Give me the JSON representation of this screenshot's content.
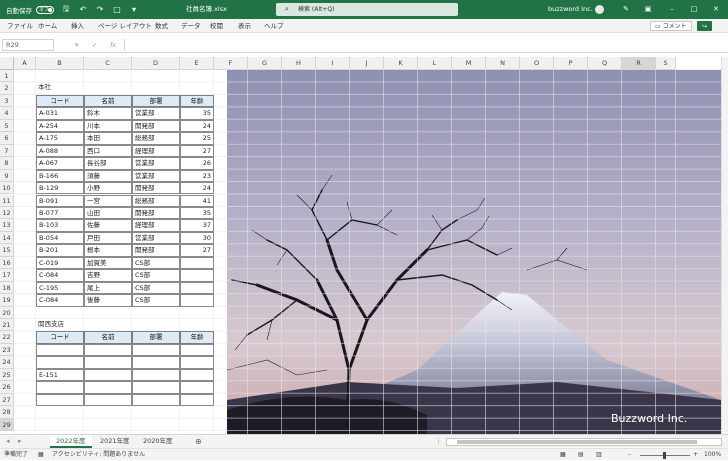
{
  "titlebar": {
    "autosave_label": "自動保存",
    "autosave_state": "オフ",
    "doc_title": "社員名簿.xlsx",
    "search_placeholder": "検索 (Alt+Q)",
    "user_name": "buzzword Inc.",
    "bg_color": "#217346"
  },
  "menu": {
    "items": [
      "ファイル",
      "ホーム",
      "挿入",
      "ページ レイアウト",
      "数式",
      "データ",
      "校閲",
      "表示",
      "ヘルプ"
    ],
    "comment_label": "コメント",
    "share_label": "共有"
  },
  "formula": {
    "cell_ref": "R29",
    "fx": "fx"
  },
  "columns": [
    "A",
    "B",
    "C",
    "D",
    "E",
    "F",
    "G",
    "H",
    "I",
    "J",
    "K",
    "L",
    "M",
    "N",
    "O",
    "P",
    "Q",
    "R",
    "S"
  ],
  "rows": [
    "1",
    "2",
    "3",
    "4",
    "5",
    "6",
    "7",
    "8",
    "9",
    "10",
    "11",
    "12",
    "13",
    "14",
    "15",
    "16",
    "17",
    "18",
    "19",
    "20",
    "21",
    "22",
    "23",
    "24",
    "25",
    "26",
    "27",
    "28",
    "29"
  ],
  "table1": {
    "title": "本社",
    "headers": [
      "コード",
      "名前",
      "部署",
      "年齢"
    ],
    "rows": [
      [
        "A-031",
        "鈴木",
        "営業部",
        "35"
      ],
      [
        "A-254",
        "川本",
        "開発部",
        "24"
      ],
      [
        "A-175",
        "本田",
        "総務部",
        "25"
      ],
      [
        "A-088",
        "西口",
        "経理部",
        "27"
      ],
      [
        "A-067",
        "長谷部",
        "営業部",
        "26"
      ],
      [
        "B-166",
        "須藤",
        "営業部",
        "23"
      ],
      [
        "B-129",
        "小野",
        "開発部",
        "24"
      ],
      [
        "B-091",
        "一宮",
        "総務部",
        "41"
      ],
      [
        "B-077",
        "山田",
        "開発部",
        "35"
      ],
      [
        "B-103",
        "佐藤",
        "経理部",
        "37"
      ],
      [
        "B-054",
        "戸田",
        "営業部",
        "30"
      ],
      [
        "B-201",
        "根本",
        "開発部",
        "27"
      ],
      [
        "C-019",
        "加賀美",
        "CS部",
        ""
      ],
      [
        "C-084",
        "吉野",
        "CS部",
        ""
      ],
      [
        "C-195",
        "尾上",
        "CS部",
        ""
      ],
      [
        "C-084",
        "後藤",
        "CS部",
        ""
      ]
    ]
  },
  "table2": {
    "title": "関西支店",
    "headers": [
      "コード",
      "名前",
      "部署",
      "年齢"
    ],
    "rows": [
      [
        "",
        "",
        "",
        ""
      ],
      [
        "",
        "",
        "",
        ""
      ],
      [
        "E-151",
        "",
        "",
        ""
      ],
      [
        "",
        "",
        "",
        ""
      ],
      [
        "",
        "",
        "",
        ""
      ]
    ]
  },
  "watermark": "Buzzword Inc.",
  "sheets": [
    "2022年度",
    "2021年度",
    "2020年度"
  ],
  "active_sheet": 0,
  "status": {
    "ready": "準備完了",
    "accessibility": "アクセシビリティ: 問題ありません",
    "zoom": "100%"
  }
}
